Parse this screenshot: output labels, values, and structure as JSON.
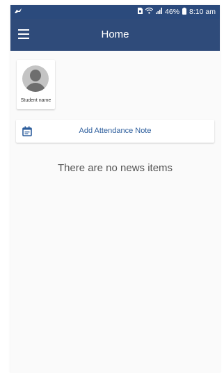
{
  "status_bar": {
    "battery": "46%",
    "time": "8:10 am"
  },
  "app_bar": {
    "title": "Home"
  },
  "student": {
    "name": "Student name"
  },
  "attendance": {
    "label": "Add Attendance Note"
  },
  "news": {
    "empty_message": "There are no news items"
  },
  "colors": {
    "header": "#2f4b7a",
    "accent": "#2c5d9c"
  },
  "icons": {
    "status_left": "bird-icon",
    "menu": "hamburger-menu-icon",
    "attendance": "calendar-note-icon"
  }
}
